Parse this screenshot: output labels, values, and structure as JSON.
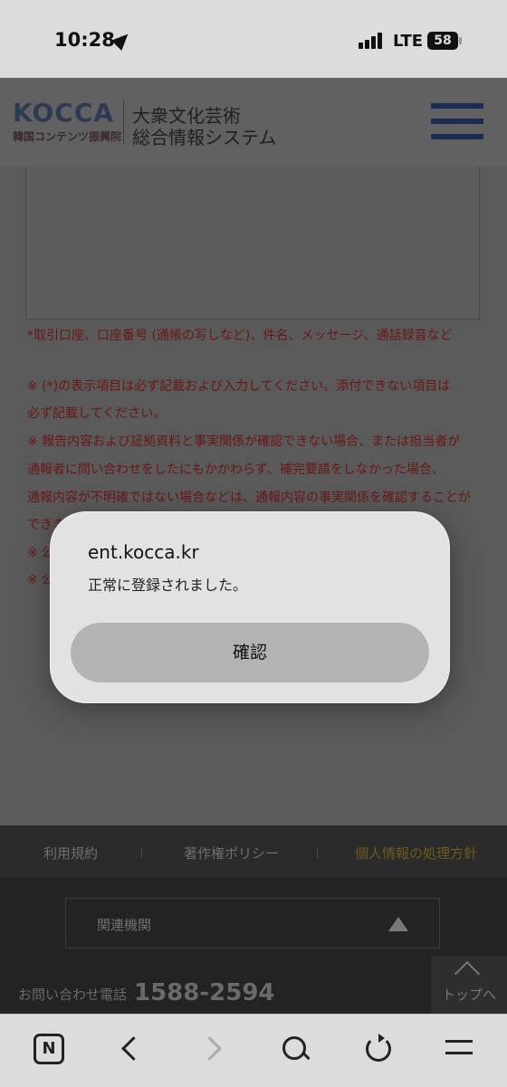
{
  "status_bar": {
    "time": "10:28",
    "network": "LTE",
    "battery": "58",
    "icons": [
      "location-arrow-icon",
      "signal-bars-icon",
      "battery-icon"
    ]
  },
  "header": {
    "logo": "KOCCA",
    "logo_subtitle": "韓国コンテンツ振興院",
    "title_line1": "大衆文化芸術",
    "title_line2": "総合情報システム",
    "menu_icon": "hamburger-menu-icon"
  },
  "form_notes": {
    "attachment_example": "*取引口座、口座番号 (通帳の写しなど)、件名、メッセージ、通話録音など",
    "lines": [
      "※ (*)の表示項目は必ず記載および入力してください。添付できない項目は",
      "必ず記載してください。",
      "※ 報告内容および証拠資料と事実関係が確認できない場合、または担当者が",
      "通報者に問い合わせをしたにもかかわらず、補完要請をしなかった場合、",
      "通報内容が不明確ではない場合などは、通報内容の事実関係を確認することが",
      "できま",
      "※ 公",
      "※ 公"
    ]
  },
  "footer": {
    "links": [
      "利用規約",
      "著作権ポリシー",
      "個人情報の処理方針"
    ],
    "related_label": "関連機関",
    "contact_label": "お問い合わせ電話",
    "contact_number": "1588-2594",
    "top_button": "トップへ"
  },
  "browser_toolbar": {
    "icons": [
      "naver-n-icon",
      "back-chevron-icon",
      "forward-chevron-icon",
      "search-icon",
      "reload-icon",
      "menu-icon"
    ],
    "n_glyph": "N"
  },
  "alert": {
    "domain": "ent.kocca.kr",
    "message": "正常に登録されました。",
    "confirm_label": "確認"
  }
}
